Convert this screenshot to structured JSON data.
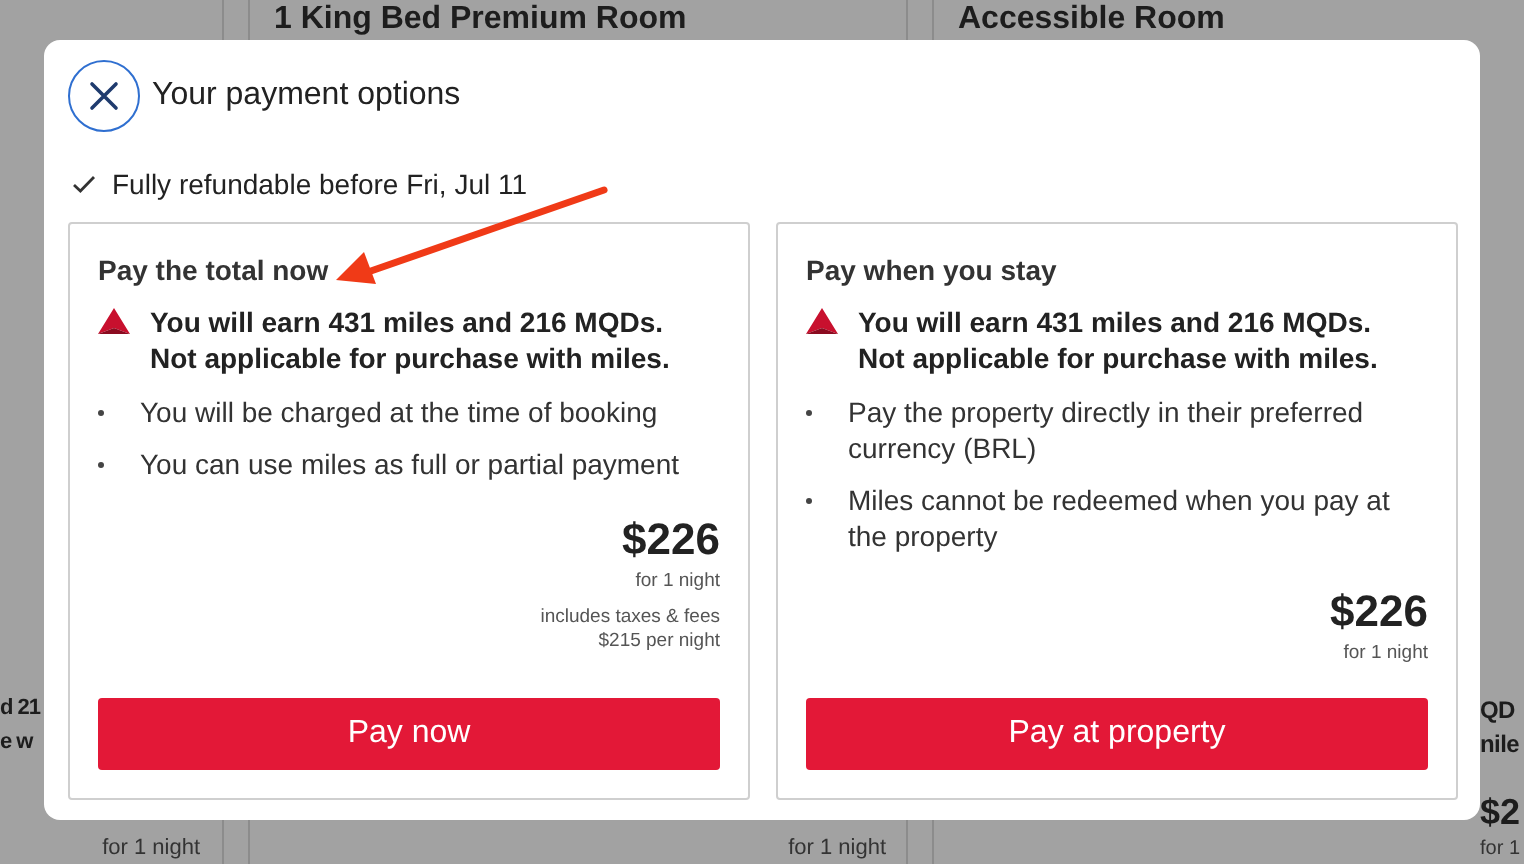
{
  "background_cards": [
    {
      "earn_lines": [
        "d 21",
        "e w"
      ],
      "price_note": "for 1 night"
    },
    {
      "title": "1 King Bed Premium Room",
      "price_note": "for 1 night"
    },
    {
      "title": "Accessible Room",
      "earn_lines": [
        "QD",
        "nile"
      ],
      "price": "$2",
      "price_note": "for 1"
    }
  ],
  "dialog": {
    "title": "Your payment options",
    "refund_note": "Fully refundable before Fri, Jul 11",
    "options": [
      {
        "heading": "Pay the total now",
        "earn_lines": [
          "You will earn 431 miles and 216 MQDs.",
          "Not applicable for purchase with miles."
        ],
        "bullets": [
          "You will be charged at the time of booking",
          "You can use miles as full or partial payment"
        ],
        "price": "$226",
        "price_note": "for 1 night",
        "fee_notes": [
          "includes taxes & fees",
          "$215 per night"
        ],
        "button": "Pay now"
      },
      {
        "heading": "Pay when you stay",
        "earn_lines": [
          "You will earn 431 miles and 216 MQDs.",
          "Not applicable for purchase with miles."
        ],
        "bullets": [
          "Pay the property directly in their preferred currency (BRL)",
          "Miles cannot be redeemed when you pay at the property"
        ],
        "price": "$226",
        "price_note": "for 1 night",
        "button": "Pay at property"
      }
    ]
  }
}
